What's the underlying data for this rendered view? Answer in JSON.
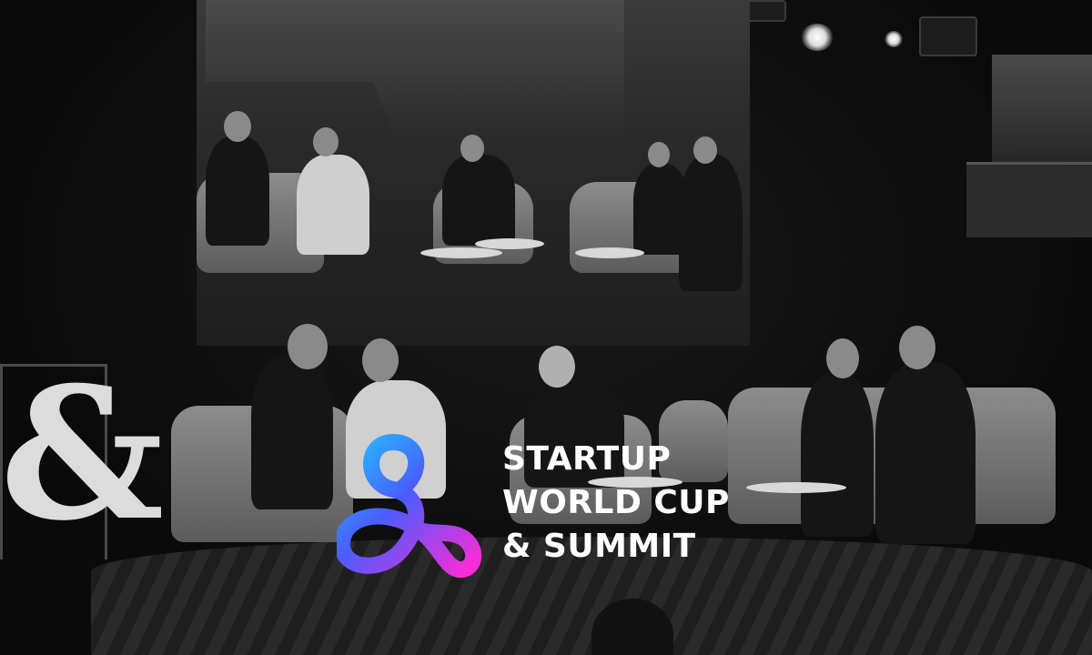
{
  "logo": {
    "symbol": "ampersand-logo",
    "colors": {
      "gradient_top": "#22c4ff",
      "gradient_mid": "#4a5cff",
      "gradient_bottom": "#ff2bd6"
    },
    "lines": [
      "STARTUP",
      "WORLD CUP",
      "& SUMMIT"
    ]
  },
  "scene": {
    "stage_prop": "&",
    "tone": "monochrome"
  }
}
